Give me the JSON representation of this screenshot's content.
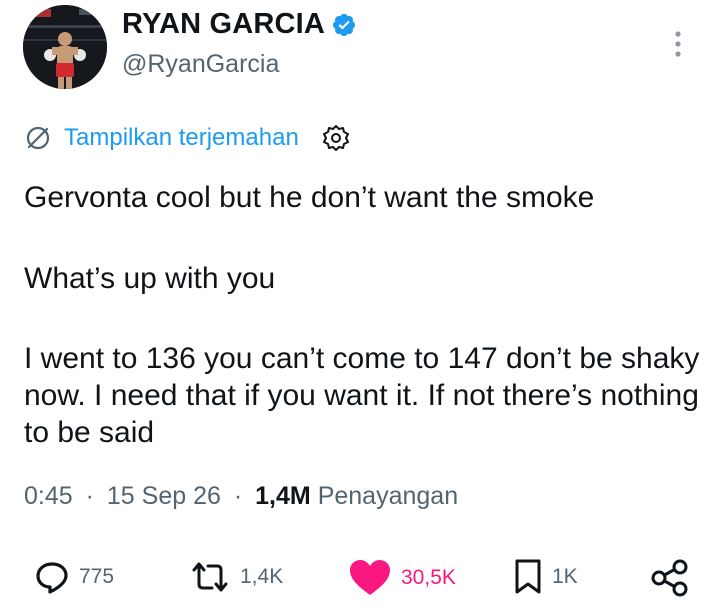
{
  "author": {
    "display_name": "RYAN GARCIA",
    "handle": "@RyanGarcia",
    "verified": true,
    "avatar_icon": "boxer-avatar"
  },
  "menu": {
    "icon": "more-vertical-icon"
  },
  "translate": {
    "label": "Tampilkan terjemahan",
    "icon": "translate-icon",
    "settings_icon": "gear-icon"
  },
  "tweet": {
    "paragraphs": [
      "Gervonta cool but he don’t want the smoke",
      "What’s up with you",
      "I went to 136 you can’t come to 147 don’t be shaky now. I need that if you want it. If not there’s nothing to be said"
    ],
    "time": "0:45",
    "separator": "·",
    "date": "15 Sep 26",
    "views_count": "1,4M",
    "views_label": "Penayangan"
  },
  "actions": {
    "reply": {
      "count": "775",
      "icon": "reply-icon"
    },
    "repost": {
      "count": "1,4K",
      "icon": "repost-icon"
    },
    "like": {
      "count": "30,5K",
      "icon": "heart-icon",
      "liked": true
    },
    "bookmark": {
      "count": "1K",
      "icon": "bookmark-icon"
    },
    "share": {
      "icon": "share-icon"
    }
  },
  "colors": {
    "accent": "#1d9bf0",
    "like": "#f91880",
    "text": "#0f1419",
    "secondary": "#536471"
  }
}
